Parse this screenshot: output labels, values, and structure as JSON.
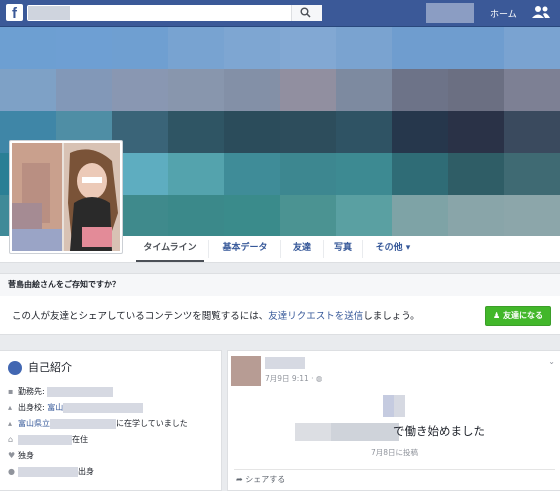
{
  "topbar": {
    "logo": "f",
    "home_label": "ホーム",
    "search_icon": "search-icon",
    "friends_icon": "friends-icon"
  },
  "tabs": [
    {
      "label": "タイムライン",
      "active": true
    },
    {
      "label": "基本データ"
    },
    {
      "label": "友達"
    },
    {
      "label": "写真"
    },
    {
      "label": "その他 ▾"
    }
  ],
  "friend_prompt": {
    "question": "菅島由絵さんをご存知ですか？",
    "text_before": "この人が友達とシェアしているコンテンツを閲覧するには、",
    "link": "友達リクエストを送信",
    "text_after": "しましょう。",
    "button": "友達になる"
  },
  "intro": {
    "title": "自己紹介",
    "work_prefix": "勤務先: ",
    "hometown_prefix": "出身校: ",
    "hometown_link": "富山",
    "school_link": "富山県立",
    "school_suffix": "に在学していました",
    "lives_suffix": "在住",
    "relationship": "独身",
    "from_suffix": "出身"
  },
  "post": {
    "date": "7月9日 9:11 · ",
    "shared_title": "で働き始めました",
    "shared_date": "7月8日に投稿",
    "share_label": "シェアする"
  },
  "colors": {
    "brand": "#3b5998",
    "link": "#365899",
    "add_button": "#42b72a"
  }
}
